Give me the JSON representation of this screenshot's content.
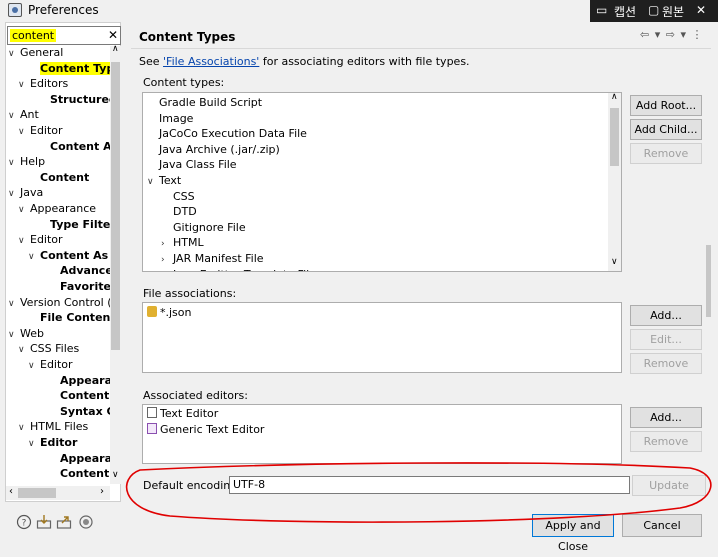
{
  "window": {
    "title": "Preferences"
  },
  "overlay": {
    "items": [
      "캡션",
      "원본",
      "✕"
    ],
    "icons": [
      "caption-icon",
      "original-icon"
    ]
  },
  "filter": {
    "value": "content",
    "clear": "✕"
  },
  "tree": [
    {
      "label": "General",
      "arrow": "∨"
    },
    {
      "label": "Content Types",
      "selected": true
    },
    {
      "label": "Editors",
      "arrow": "∨"
    },
    {
      "label": "Structured"
    },
    {
      "label": "Ant",
      "arrow": "∨"
    },
    {
      "label": "Editor",
      "arrow": "∨"
    },
    {
      "label": "Content As"
    },
    {
      "label": "Help",
      "arrow": "∨"
    },
    {
      "label": "Content"
    },
    {
      "label": "Java",
      "arrow": "∨"
    },
    {
      "label": "Appearance",
      "arrow": "∨"
    },
    {
      "label": "Type Filters"
    },
    {
      "label": "Editor",
      "arrow": "∨"
    },
    {
      "label": "Content As",
      "arrow": "∨"
    },
    {
      "label": "Advance"
    },
    {
      "label": "Favorites"
    },
    {
      "label": "Version Control (",
      "arrow": "∨"
    },
    {
      "label": "File Content"
    },
    {
      "label": "Web",
      "arrow": "∨"
    },
    {
      "label": "CSS Files",
      "arrow": "∨"
    },
    {
      "label": "Editor",
      "arrow": "∨"
    },
    {
      "label": "Appeara"
    },
    {
      "label": "Content"
    },
    {
      "label": "Syntax C"
    },
    {
      "label": "HTML Files",
      "arrow": "∨"
    },
    {
      "label": "Editor",
      "arrow": "∨"
    },
    {
      "label": "Appeara"
    },
    {
      "label": "Content"
    }
  ],
  "page": {
    "title": "Content Types",
    "nav": "⇦ ▾ ⇨ ▾ ⋮",
    "desc_before": "See ",
    "desc_link": "'File Associations'",
    "desc_after": " for associating editors with file types."
  },
  "content_types": {
    "label": "Content types:",
    "items": [
      {
        "label": "Gradle Build Script"
      },
      {
        "label": "Image"
      },
      {
        "label": "JaCoCo Execution Data File"
      },
      {
        "label": "Java Archive (.jar/.zip)"
      },
      {
        "label": "Java Class File"
      },
      {
        "label": "Text",
        "arrow": "∨"
      },
      {
        "label": "CSS"
      },
      {
        "label": "DTD"
      },
      {
        "label": "Gitignore File"
      },
      {
        "label": "HTML",
        "arrow": "›"
      },
      {
        "label": "JAR Manifest File",
        "arrow": "›"
      },
      {
        "label": "Java Emitter Template File"
      }
    ],
    "buttons": {
      "add_root": "Add Root...",
      "add_child": "Add Child...",
      "remove": "Remove"
    }
  },
  "file_associations": {
    "label": "File associations:",
    "items": [
      "*.json"
    ],
    "buttons": {
      "add": "Add...",
      "edit": "Edit...",
      "remove": "Remove"
    }
  },
  "associated_editors": {
    "label": "Associated editors:",
    "items": [
      "Text Editor",
      "Generic Text Editor"
    ],
    "buttons": {
      "add": "Add...",
      "remove": "Remove"
    }
  },
  "encoding": {
    "label": "Default encoding:",
    "value": "UTF-8",
    "update": "Update"
  },
  "footer": {
    "apply_close": "Apply and Close",
    "cancel": "Cancel"
  },
  "colors": {
    "highlight": "#ffff00",
    "annotation": "#e00000",
    "link": "#0645ad",
    "accent": "#0078d7"
  }
}
